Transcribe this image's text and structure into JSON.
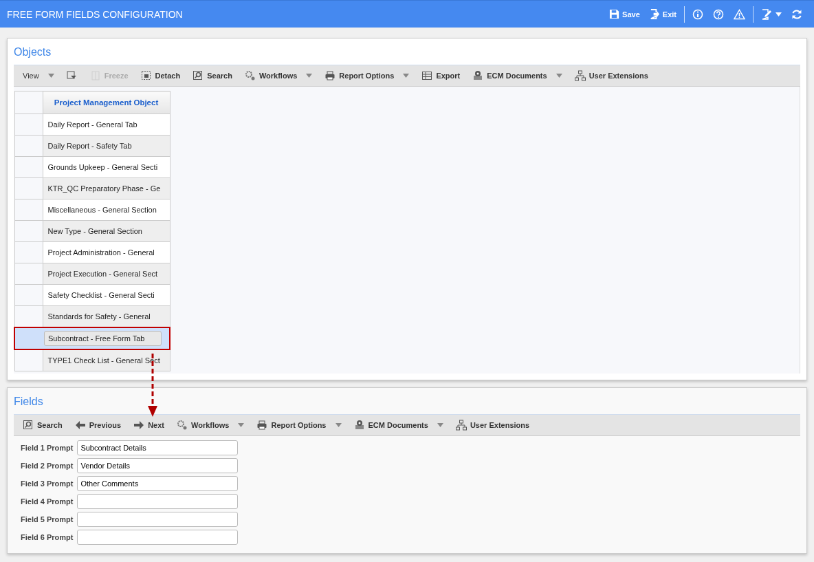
{
  "window": {
    "title": "FREE FORM FIELDS CONFIGURATION"
  },
  "header_actions": [
    {
      "kind": "save",
      "label": "Save"
    },
    {
      "kind": "exit",
      "label": "Exit"
    },
    {
      "kind": "info"
    },
    {
      "kind": "help"
    },
    {
      "kind": "warning"
    },
    {
      "kind": "edit-menu"
    },
    {
      "kind": "refresh"
    }
  ],
  "objects": {
    "title": "Objects",
    "toolbar": [
      {
        "kind": "view",
        "label": "View",
        "dropdown": true,
        "disabled": false
      },
      {
        "kind": "filter",
        "dropdown": false,
        "disabled": false
      },
      {
        "kind": "freeze",
        "label": "Freeze",
        "dropdown": false,
        "disabled": true
      },
      {
        "kind": "detach",
        "label": "Detach",
        "dropdown": false,
        "disabled": false
      },
      {
        "kind": "search",
        "label": "Search",
        "dropdown": false,
        "disabled": false
      },
      {
        "kind": "workflows",
        "label": "Workflows",
        "dropdown": true,
        "disabled": false
      },
      {
        "kind": "print",
        "label": "Report Options",
        "dropdown": true,
        "disabled": false
      },
      {
        "kind": "export",
        "label": "Export",
        "dropdown": false,
        "disabled": false
      },
      {
        "kind": "ecm",
        "label": "ECM Documents",
        "dropdown": true,
        "disabled": false
      },
      {
        "kind": "extensions",
        "label": "User Extensions",
        "dropdown": false,
        "disabled": false
      }
    ],
    "table": {
      "columns": [
        "Project Management Object"
      ],
      "rows": [
        {
          "cell": "Daily Report - General Tab",
          "selected": false
        },
        {
          "cell": "Daily Report - Safety Tab",
          "selected": false
        },
        {
          "cell": "Grounds Upkeep - General Secti",
          "selected": false
        },
        {
          "cell": "KTR_QC Preparatory Phase - Ge",
          "selected": false
        },
        {
          "cell": "Miscellaneous - General Section",
          "selected": false
        },
        {
          "cell": "New Type - General Section",
          "selected": false
        },
        {
          "cell": "Project Administration - General",
          "selected": false
        },
        {
          "cell": "Project Execution - General Sect",
          "selected": false
        },
        {
          "cell": "Safety Checklist - General Secti",
          "selected": false
        },
        {
          "cell": "Standards for Safety - General",
          "selected": false
        },
        {
          "cell": "Subcontract - Free Form Tab",
          "selected": true
        },
        {
          "cell": "TYPE1 Check List - General Sect",
          "selected": false
        }
      ]
    }
  },
  "fields": {
    "title": "Fields",
    "toolbar": [
      {
        "kind": "search",
        "label": "Search",
        "dropdown": false,
        "disabled": false
      },
      {
        "kind": "prev",
        "label": "Previous",
        "dropdown": false,
        "disabled": false
      },
      {
        "kind": "next",
        "label": "Next",
        "dropdown": false,
        "disabled": false
      },
      {
        "kind": "workflows",
        "label": "Workflows",
        "dropdown": true,
        "disabled": false
      },
      {
        "kind": "print",
        "label": "Report Options",
        "dropdown": true,
        "disabled": false
      },
      {
        "kind": "ecm",
        "label": "ECM Documents",
        "dropdown": true,
        "disabled": false
      },
      {
        "kind": "extensions",
        "label": "User Extensions",
        "dropdown": false,
        "disabled": false
      }
    ],
    "form": [
      {
        "label": "Field 1 Prompt",
        "value": "Subcontract Details"
      },
      {
        "label": "Field 2 Prompt",
        "value": "Vendor Details"
      },
      {
        "label": "Field 3 Prompt",
        "value": "Other Comments"
      },
      {
        "label": "Field 4 Prompt"
      },
      {
        "label": "Field 5 Prompt"
      },
      {
        "label": "Field 6 Prompt"
      }
    ]
  }
}
